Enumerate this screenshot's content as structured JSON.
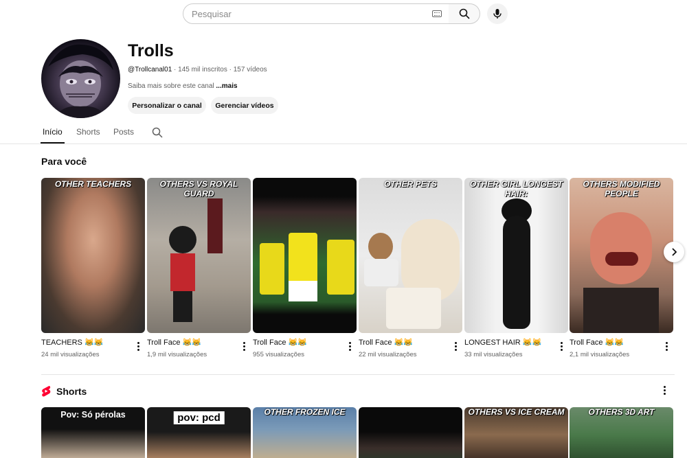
{
  "search": {
    "placeholder": "Pesquisar"
  },
  "channel": {
    "name": "Trolls",
    "handle": "@Trollcanal01",
    "subscribers": "145 mil inscritos",
    "videos": "157 vídeos",
    "meta_sep": " · ",
    "about_prefix": "Saiba mais sobre este canal ",
    "about_more": "...mais",
    "customize_label": "Personalizar o canal",
    "manage_label": "Gerenciar vídeos"
  },
  "tabs": [
    {
      "label": "Início",
      "active": true
    },
    {
      "label": "Shorts",
      "active": false
    },
    {
      "label": "Posts",
      "active": false
    }
  ],
  "for_you": {
    "title": "Para você",
    "videos": [
      {
        "caption": "OTHER TEACHERS",
        "title": "TEACHERS 😹😹",
        "views": "24 mil visualizações"
      },
      {
        "caption": "OTHERS VS ROYAL GUARD",
        "title": "Troll Face 😹😹",
        "views": "1,9 mil visualizações"
      },
      {
        "caption": "",
        "title": "Troll Face 😹😹",
        "views": "955 visualizações"
      },
      {
        "caption": "OTHER PETS",
        "title": "Troll Face 😹😹",
        "views": "22 mil visualizações"
      },
      {
        "caption": "OTHER GIRL LONGEST HAIR:",
        "title": "LONGEST HAIR 😹😹",
        "views": "33 mil visualizações"
      },
      {
        "caption": "OTHERS MODIFIED PEOPLE",
        "title": "Troll Face 😹😹",
        "views": "2,1 mil visualizações"
      }
    ]
  },
  "shorts": {
    "title": "Shorts",
    "items": [
      {
        "caption": "Pov: Só pérolas"
      },
      {
        "caption": "pov: pcd"
      },
      {
        "caption": "OTHER FROZEN ICE"
      },
      {
        "caption": ""
      },
      {
        "caption": "OTHERS VS ICE CREAM"
      },
      {
        "caption": "OTHERS 3D ART"
      }
    ]
  },
  "colors": {
    "shorts_red": "#ff0033",
    "text_secondary": "#606060",
    "pill_bg": "#f2f2f2"
  },
  "icons": [
    "keyboard-icon",
    "search-icon",
    "mic-icon",
    "chevron-right-icon",
    "kebab-icon",
    "shorts-logo-icon"
  ]
}
